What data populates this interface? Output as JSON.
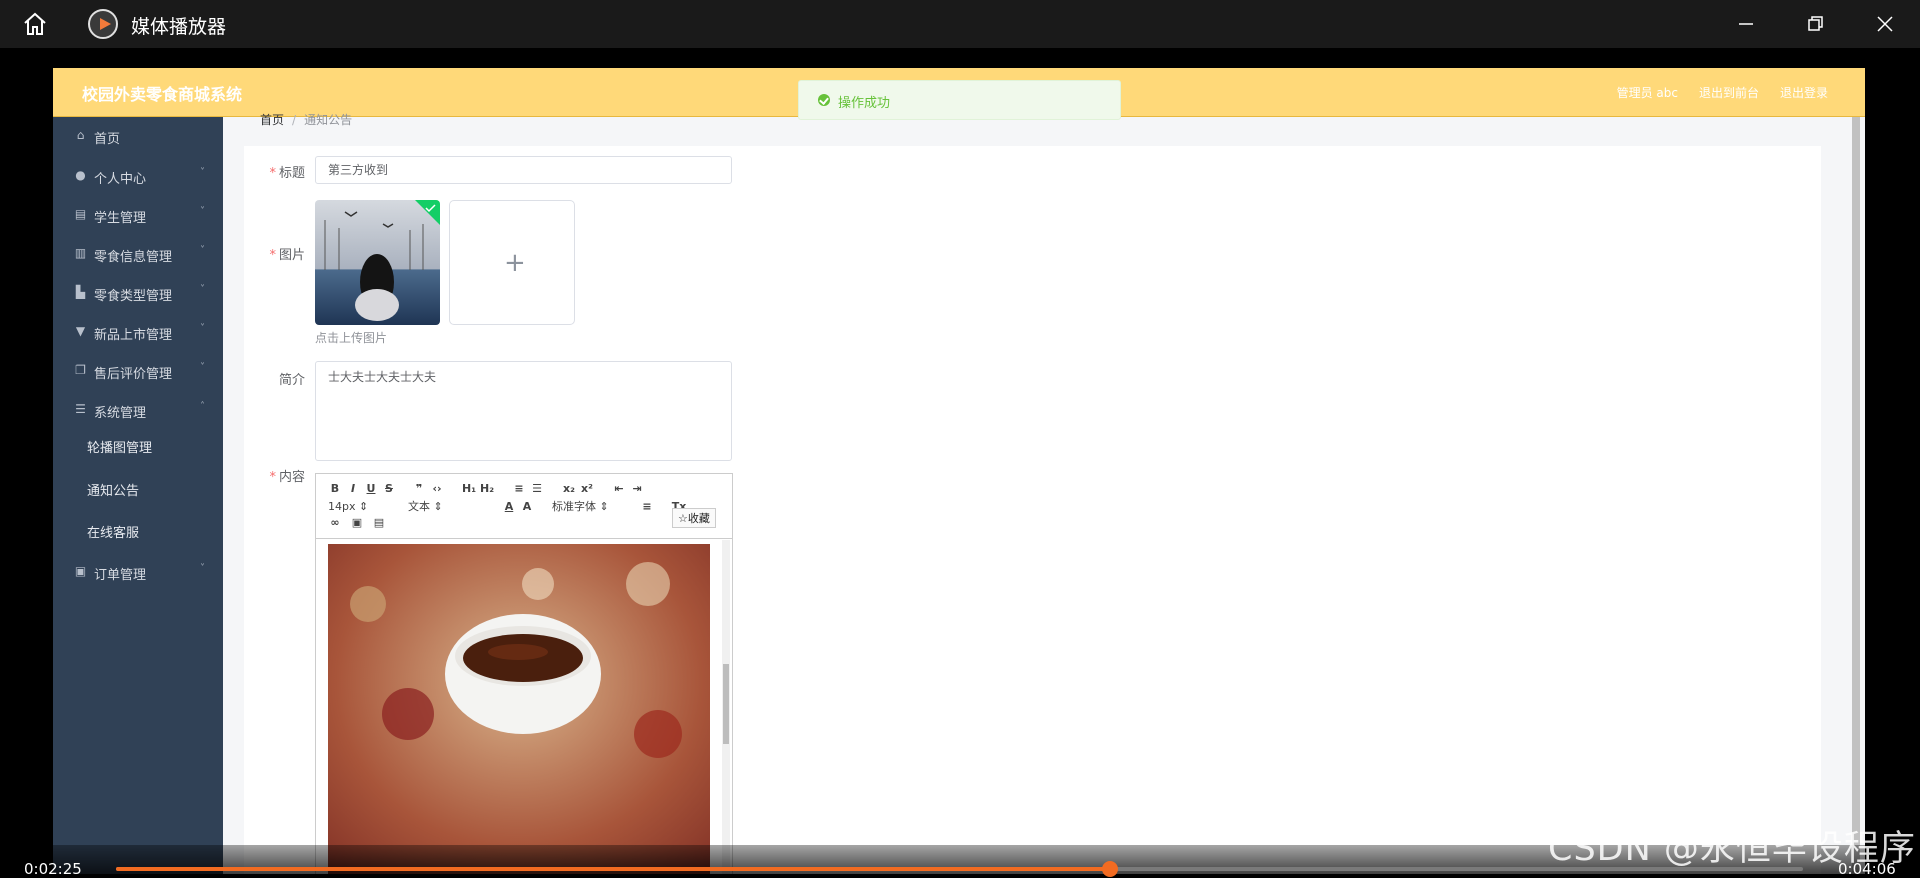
{
  "window": {
    "title": "媒体播放器"
  },
  "app": {
    "brand": "校园外卖零食商城系统",
    "top_links": [
      "管理员 abc",
      "退出到前台",
      "退出登录"
    ],
    "toast": "操作成功"
  },
  "sidebar": {
    "items": [
      {
        "label": "首页",
        "icon": "home-icon",
        "chevron": ""
      },
      {
        "label": "个人中心",
        "icon": "user-icon",
        "chevron": "˅"
      },
      {
        "label": "学生管理",
        "icon": "clipboard-icon",
        "chevron": "˅"
      },
      {
        "label": "零食信息管理",
        "icon": "bar-chart-icon",
        "chevron": "˅"
      },
      {
        "label": "零食类型管理",
        "icon": "building-icon",
        "chevron": "˅"
      },
      {
        "label": "新品上市管理",
        "icon": "cup-icon",
        "chevron": "˅"
      },
      {
        "label": "售后评价管理",
        "icon": "copy-icon",
        "chevron": "˅"
      },
      {
        "label": "系统管理",
        "icon": "list-icon",
        "chevron": "˄"
      },
      {
        "label": "订单管理",
        "icon": "calendar-icon",
        "chevron": "˅"
      }
    ],
    "submenu": [
      "轮播图管理",
      "通知公告",
      "在线客服"
    ]
  },
  "breadcrumb": {
    "home": "首页",
    "current": "通知公告"
  },
  "form": {
    "title_label": "标题",
    "title_value": "第三方收到",
    "image_label": "图片",
    "upload_hint": "点击上传图片",
    "intro_label": "简介",
    "intro_value": "士大夫士大夫士大夫",
    "content_label": "内容"
  },
  "editor": {
    "font_size": "14px",
    "paragraph": "文本",
    "font_family": "标准字体",
    "fav": "收藏"
  },
  "player": {
    "elapsed": "0:02:25",
    "duration": "0:04:06",
    "progress": 0.5894
  },
  "watermark": "CSDN @永恒毕设程序",
  "colors": {
    "topbar": "#ffd979",
    "sidebar": "#304156",
    "accent": "#f26b21",
    "success": "#67c23a"
  }
}
